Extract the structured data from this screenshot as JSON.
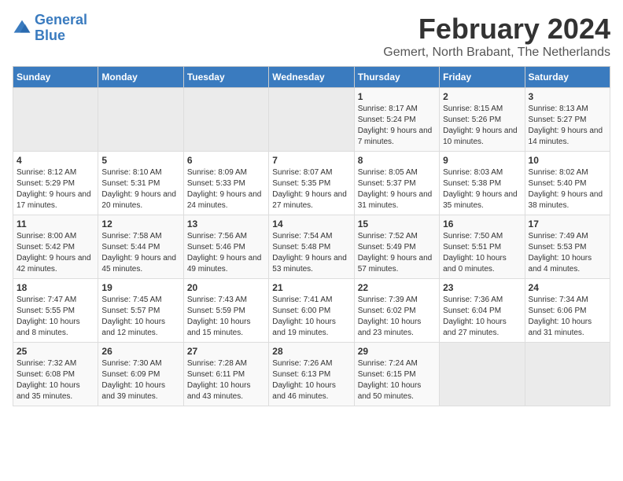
{
  "logo": {
    "line1": "General",
    "line2": "Blue"
  },
  "title": "February 2024",
  "subtitle": "Gemert, North Brabant, The Netherlands",
  "days_of_week": [
    "Sunday",
    "Monday",
    "Tuesday",
    "Wednesday",
    "Thursday",
    "Friday",
    "Saturday"
  ],
  "weeks": [
    [
      {
        "day": "",
        "info": ""
      },
      {
        "day": "",
        "info": ""
      },
      {
        "day": "",
        "info": ""
      },
      {
        "day": "",
        "info": ""
      },
      {
        "day": "1",
        "info": "Sunrise: 8:17 AM\nSunset: 5:24 PM\nDaylight: 9 hours\nand 7 minutes."
      },
      {
        "day": "2",
        "info": "Sunrise: 8:15 AM\nSunset: 5:26 PM\nDaylight: 9 hours\nand 10 minutes."
      },
      {
        "day": "3",
        "info": "Sunrise: 8:13 AM\nSunset: 5:27 PM\nDaylight: 9 hours\nand 14 minutes."
      }
    ],
    [
      {
        "day": "4",
        "info": "Sunrise: 8:12 AM\nSunset: 5:29 PM\nDaylight: 9 hours\nand 17 minutes."
      },
      {
        "day": "5",
        "info": "Sunrise: 8:10 AM\nSunset: 5:31 PM\nDaylight: 9 hours\nand 20 minutes."
      },
      {
        "day": "6",
        "info": "Sunrise: 8:09 AM\nSunset: 5:33 PM\nDaylight: 9 hours\nand 24 minutes."
      },
      {
        "day": "7",
        "info": "Sunrise: 8:07 AM\nSunset: 5:35 PM\nDaylight: 9 hours\nand 27 minutes."
      },
      {
        "day": "8",
        "info": "Sunrise: 8:05 AM\nSunset: 5:37 PM\nDaylight: 9 hours\nand 31 minutes."
      },
      {
        "day": "9",
        "info": "Sunrise: 8:03 AM\nSunset: 5:38 PM\nDaylight: 9 hours\nand 35 minutes."
      },
      {
        "day": "10",
        "info": "Sunrise: 8:02 AM\nSunset: 5:40 PM\nDaylight: 9 hours\nand 38 minutes."
      }
    ],
    [
      {
        "day": "11",
        "info": "Sunrise: 8:00 AM\nSunset: 5:42 PM\nDaylight: 9 hours\nand 42 minutes."
      },
      {
        "day": "12",
        "info": "Sunrise: 7:58 AM\nSunset: 5:44 PM\nDaylight: 9 hours\nand 45 minutes."
      },
      {
        "day": "13",
        "info": "Sunrise: 7:56 AM\nSunset: 5:46 PM\nDaylight: 9 hours\nand 49 minutes."
      },
      {
        "day": "14",
        "info": "Sunrise: 7:54 AM\nSunset: 5:48 PM\nDaylight: 9 hours\nand 53 minutes."
      },
      {
        "day": "15",
        "info": "Sunrise: 7:52 AM\nSunset: 5:49 PM\nDaylight: 9 hours\nand 57 minutes."
      },
      {
        "day": "16",
        "info": "Sunrise: 7:50 AM\nSunset: 5:51 PM\nDaylight: 10 hours\nand 0 minutes."
      },
      {
        "day": "17",
        "info": "Sunrise: 7:49 AM\nSunset: 5:53 PM\nDaylight: 10 hours\nand 4 minutes."
      }
    ],
    [
      {
        "day": "18",
        "info": "Sunrise: 7:47 AM\nSunset: 5:55 PM\nDaylight: 10 hours\nand 8 minutes."
      },
      {
        "day": "19",
        "info": "Sunrise: 7:45 AM\nSunset: 5:57 PM\nDaylight: 10 hours\nand 12 minutes."
      },
      {
        "day": "20",
        "info": "Sunrise: 7:43 AM\nSunset: 5:59 PM\nDaylight: 10 hours\nand 15 minutes."
      },
      {
        "day": "21",
        "info": "Sunrise: 7:41 AM\nSunset: 6:00 PM\nDaylight: 10 hours\nand 19 minutes."
      },
      {
        "day": "22",
        "info": "Sunrise: 7:39 AM\nSunset: 6:02 PM\nDaylight: 10 hours\nand 23 minutes."
      },
      {
        "day": "23",
        "info": "Sunrise: 7:36 AM\nSunset: 6:04 PM\nDaylight: 10 hours\nand 27 minutes."
      },
      {
        "day": "24",
        "info": "Sunrise: 7:34 AM\nSunset: 6:06 PM\nDaylight: 10 hours\nand 31 minutes."
      }
    ],
    [
      {
        "day": "25",
        "info": "Sunrise: 7:32 AM\nSunset: 6:08 PM\nDaylight: 10 hours\nand 35 minutes."
      },
      {
        "day": "26",
        "info": "Sunrise: 7:30 AM\nSunset: 6:09 PM\nDaylight: 10 hours\nand 39 minutes."
      },
      {
        "day": "27",
        "info": "Sunrise: 7:28 AM\nSunset: 6:11 PM\nDaylight: 10 hours\nand 43 minutes."
      },
      {
        "day": "28",
        "info": "Sunrise: 7:26 AM\nSunset: 6:13 PM\nDaylight: 10 hours\nand 46 minutes."
      },
      {
        "day": "29",
        "info": "Sunrise: 7:24 AM\nSunset: 6:15 PM\nDaylight: 10 hours\nand 50 minutes."
      },
      {
        "day": "",
        "info": ""
      },
      {
        "day": "",
        "info": ""
      }
    ]
  ]
}
